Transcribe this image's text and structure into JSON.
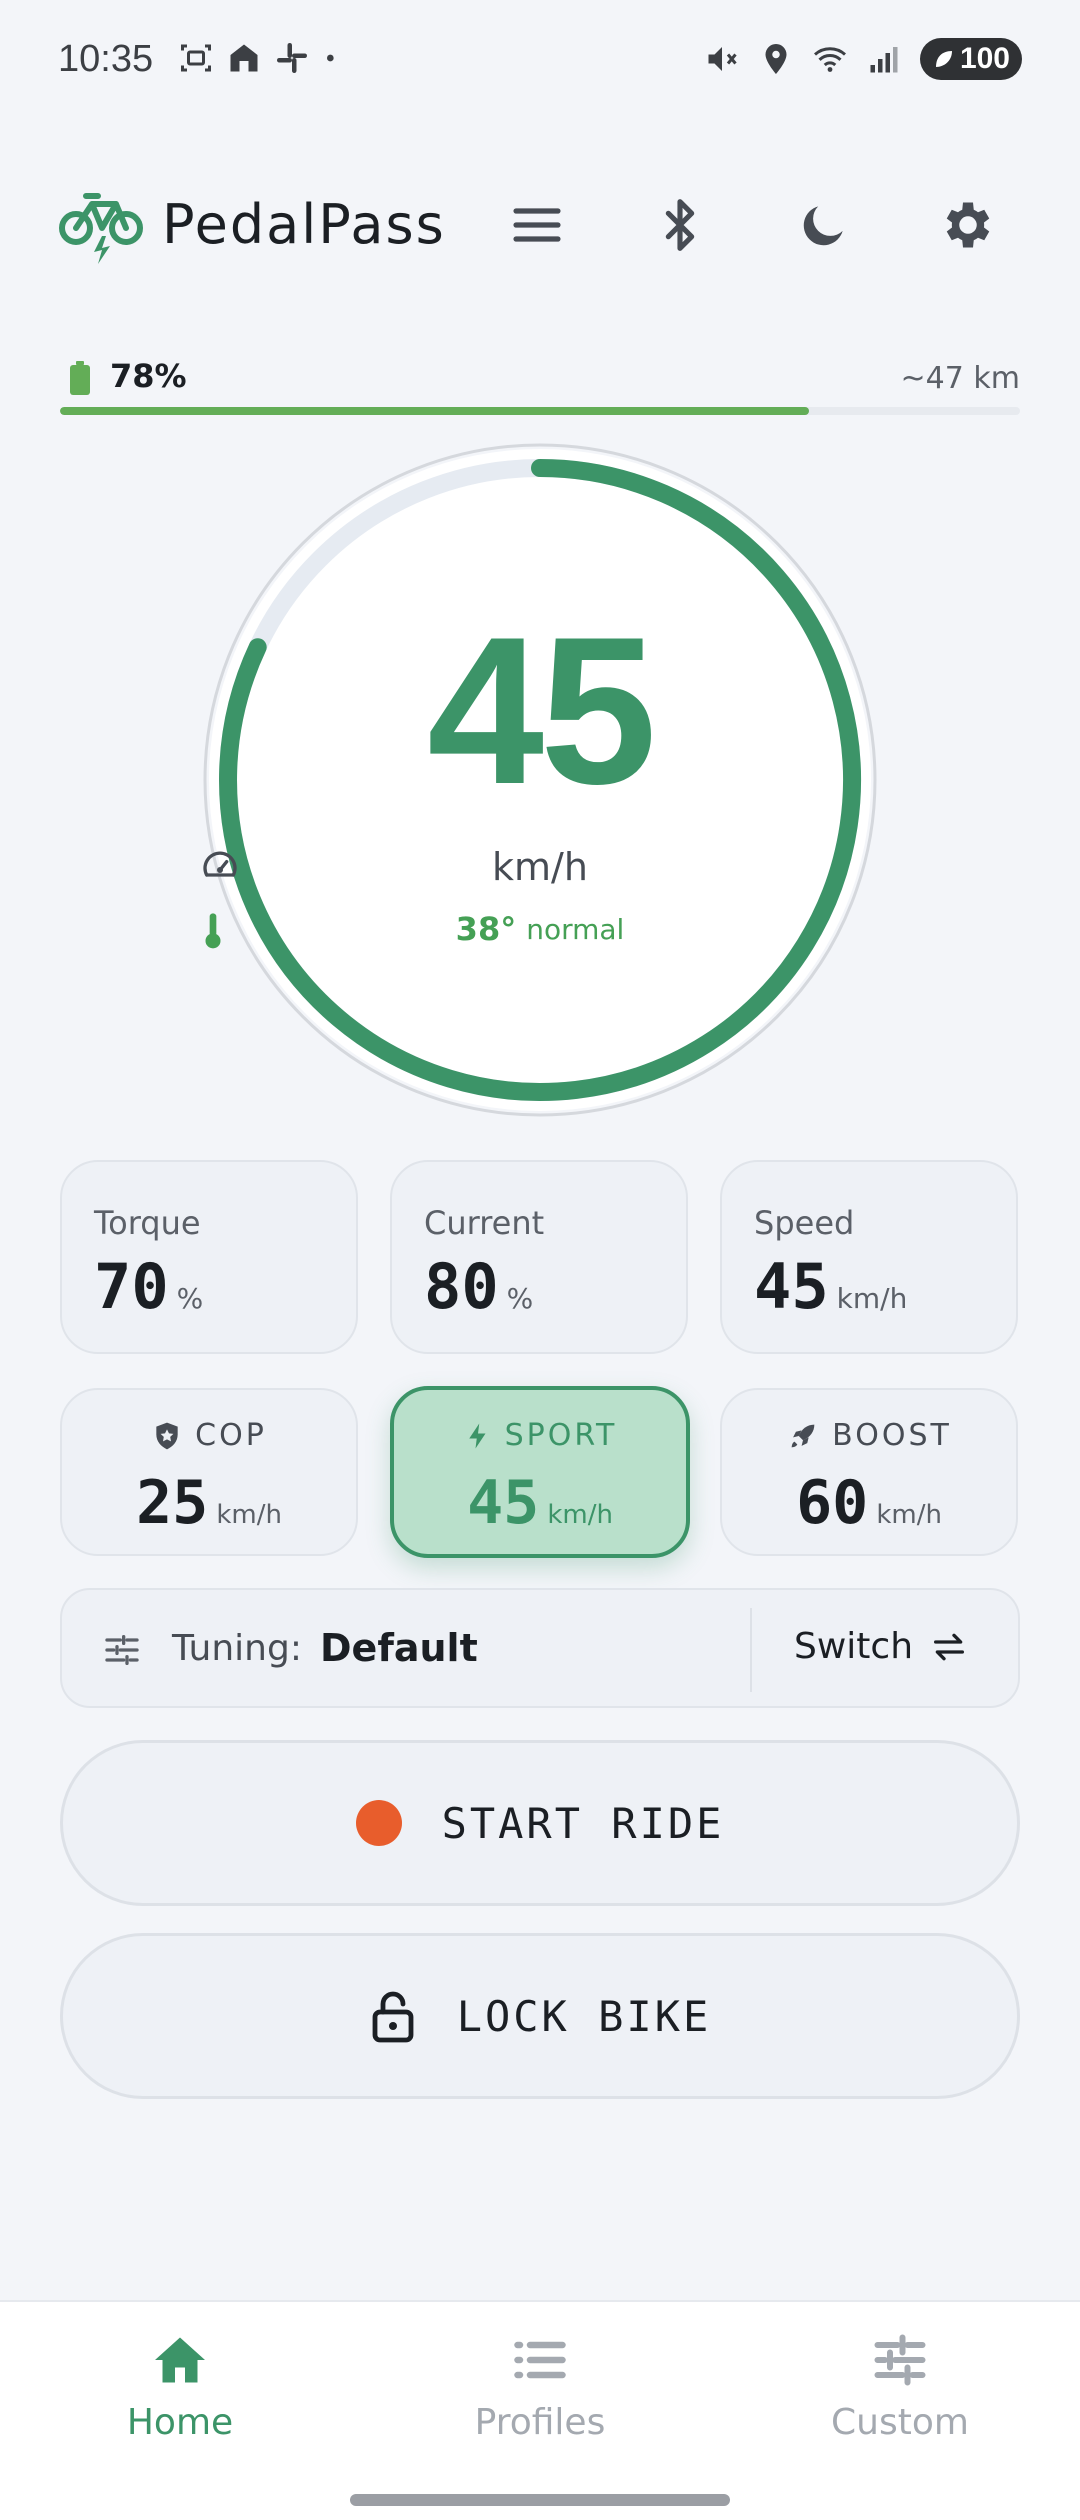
{
  "status_bar": {
    "time": "10:35",
    "battery": "100"
  },
  "app": {
    "name": "PedalPass"
  },
  "battery": {
    "percent_label": "78%",
    "level_fraction": 0.78,
    "range_label": "~47 km"
  },
  "speedometer": {
    "speed": "45",
    "unit": "km/h",
    "temperature": "38°",
    "temp_status": "normal",
    "arc_fraction": 0.82
  },
  "stats": [
    {
      "label": "Torque",
      "value": "70",
      "unit": "%"
    },
    {
      "label": "Current",
      "value": "80",
      "unit": "%"
    },
    {
      "label": "Speed",
      "value": "45",
      "unit": "km/h"
    }
  ],
  "modes": [
    {
      "label": "COP",
      "value": "25",
      "unit": "km/h",
      "icon": "shield-star-icon",
      "active": false
    },
    {
      "label": "SPORT",
      "value": "45",
      "unit": "km/h",
      "icon": "bolt-icon",
      "active": true
    },
    {
      "label": "BOOST",
      "value": "60",
      "unit": "km/h",
      "icon": "rocket-icon",
      "active": false
    }
  ],
  "tuning": {
    "label": "Tuning:",
    "value": "Default",
    "switch_label": "Switch"
  },
  "actions": {
    "start_ride": "START RIDE",
    "lock_bike": "LOCK BIKE"
  },
  "nav": [
    {
      "label": "Home",
      "icon": "home-icon",
      "active": true
    },
    {
      "label": "Profiles",
      "icon": "list-icon",
      "active": false
    },
    {
      "label": "Custom",
      "icon": "sliders-icon",
      "active": false
    }
  ],
  "colors": {
    "accent": "#3c9468",
    "battery": "#63ad57",
    "record": "#e85d2c",
    "background": "#f3f5f9"
  }
}
